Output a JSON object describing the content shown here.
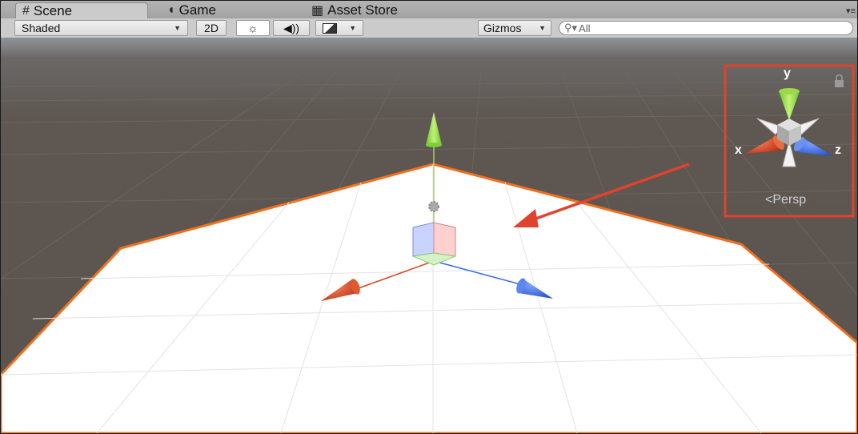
{
  "tabs": [
    {
      "label": "Scene",
      "icon": "grid-icon",
      "active": true
    },
    {
      "label": "Game",
      "icon": "pacman-icon",
      "active": false
    },
    {
      "label": "Asset Store",
      "icon": "bag-icon",
      "active": false
    }
  ],
  "toolbar": {
    "shading_mode": "Shaded",
    "mode_2d_label": "2D",
    "gizmos_label": "Gizmos",
    "search_placeholder": "All",
    "search_value": ""
  },
  "scene_gizmo": {
    "y_label": "y",
    "x_label": "x",
    "z_label": "z",
    "projection_label": "Persp",
    "lock_icon": "lock-icon"
  },
  "colors": {
    "highlight": "#e0432d",
    "axis_x": "#d8421f",
    "axis_y": "#8cd43a",
    "axis_z": "#3366e6",
    "plane_outline": "#f07020"
  }
}
